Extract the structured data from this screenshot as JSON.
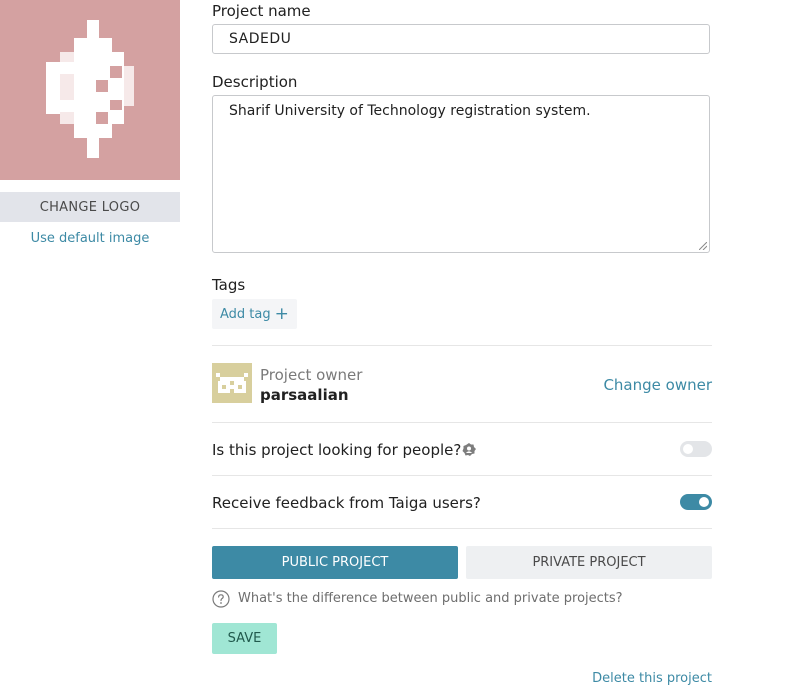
{
  "logo": {
    "change_label": "CHANGE LOGO",
    "default_label": "Use default image",
    "background": "#d4a1a1"
  },
  "form": {
    "project_name_label": "Project name",
    "project_name_value": "SADEDU",
    "description_label": "Description",
    "description_value": "Sharif University of Technology registration system.",
    "tags_label": "Tags",
    "add_tag_label": "Add tag",
    "add_tag_icon": "plus-icon"
  },
  "owner": {
    "label": "Project owner",
    "name": "parsaalian",
    "change_label": "Change owner"
  },
  "settings": {
    "looking_for_people": {
      "label": "Is this project looking for people?",
      "icon": "info-icon",
      "enabled": false
    },
    "receive_feedback": {
      "label": "Receive feedback from Taiga users?",
      "enabled": true
    }
  },
  "privacy": {
    "public_label": "PUBLIC PROJECT",
    "private_label": "PRIVATE PROJECT",
    "selected": "public",
    "help_text": "What's the difference between public and private projects?"
  },
  "actions": {
    "save_label": "SAVE",
    "delete_label": "Delete this project"
  },
  "colors": {
    "accent": "#3d8aa5",
    "save": "#a0e6d4"
  }
}
